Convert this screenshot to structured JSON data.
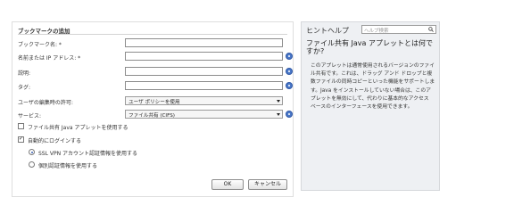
{
  "form": {
    "title": "ブックマークの追加",
    "fields": [
      {
        "label": "ブックマーク名: *",
        "value": ""
      },
      {
        "label": "名前または IP アドレス: *",
        "value": ""
      },
      {
        "label": "説明:",
        "value": ""
      },
      {
        "label": "タグ:",
        "value": ""
      }
    ],
    "edit_permission": {
      "label": "ユーザの編集時の許可:",
      "selected": "ユーザ ポリシーを使用"
    },
    "service": {
      "label": "サービス:",
      "selected": "ファイル共有 (CIFS)"
    },
    "use_java_applet": {
      "label": "ファイル共有 Java アプレットを使用する",
      "checked": false
    },
    "auto_login": {
      "label": "自動的にログインする",
      "checked": true
    },
    "radio_sslvpn": {
      "label": "SSL VPN アカウント認証情報を使用する",
      "checked": true
    },
    "radio_custom": {
      "label": "個別認証情報を使用する",
      "checked": false
    },
    "ok_label": "OK",
    "cancel_label": "キャンセル"
  },
  "help": {
    "title": "ヒントヘルプ",
    "search_placeholder": "ヘルプ検索",
    "heading": "ファイル共有 Java アプレットとは何ですか?",
    "body": "このアプレットは通常使用されるバージョンのファイル共有です。これは、ドラッグ アンド ドロップと複数ファイルの同時コピーといった機能をサポートします。Java をインストールしていない場合は、このアプレットを無効にして、代わりに基本的なアクセス ベースのインターフェースを使用できます。"
  },
  "colors": {
    "info_icon": "#4a78c8",
    "panel_bg": "#eef0f3"
  }
}
